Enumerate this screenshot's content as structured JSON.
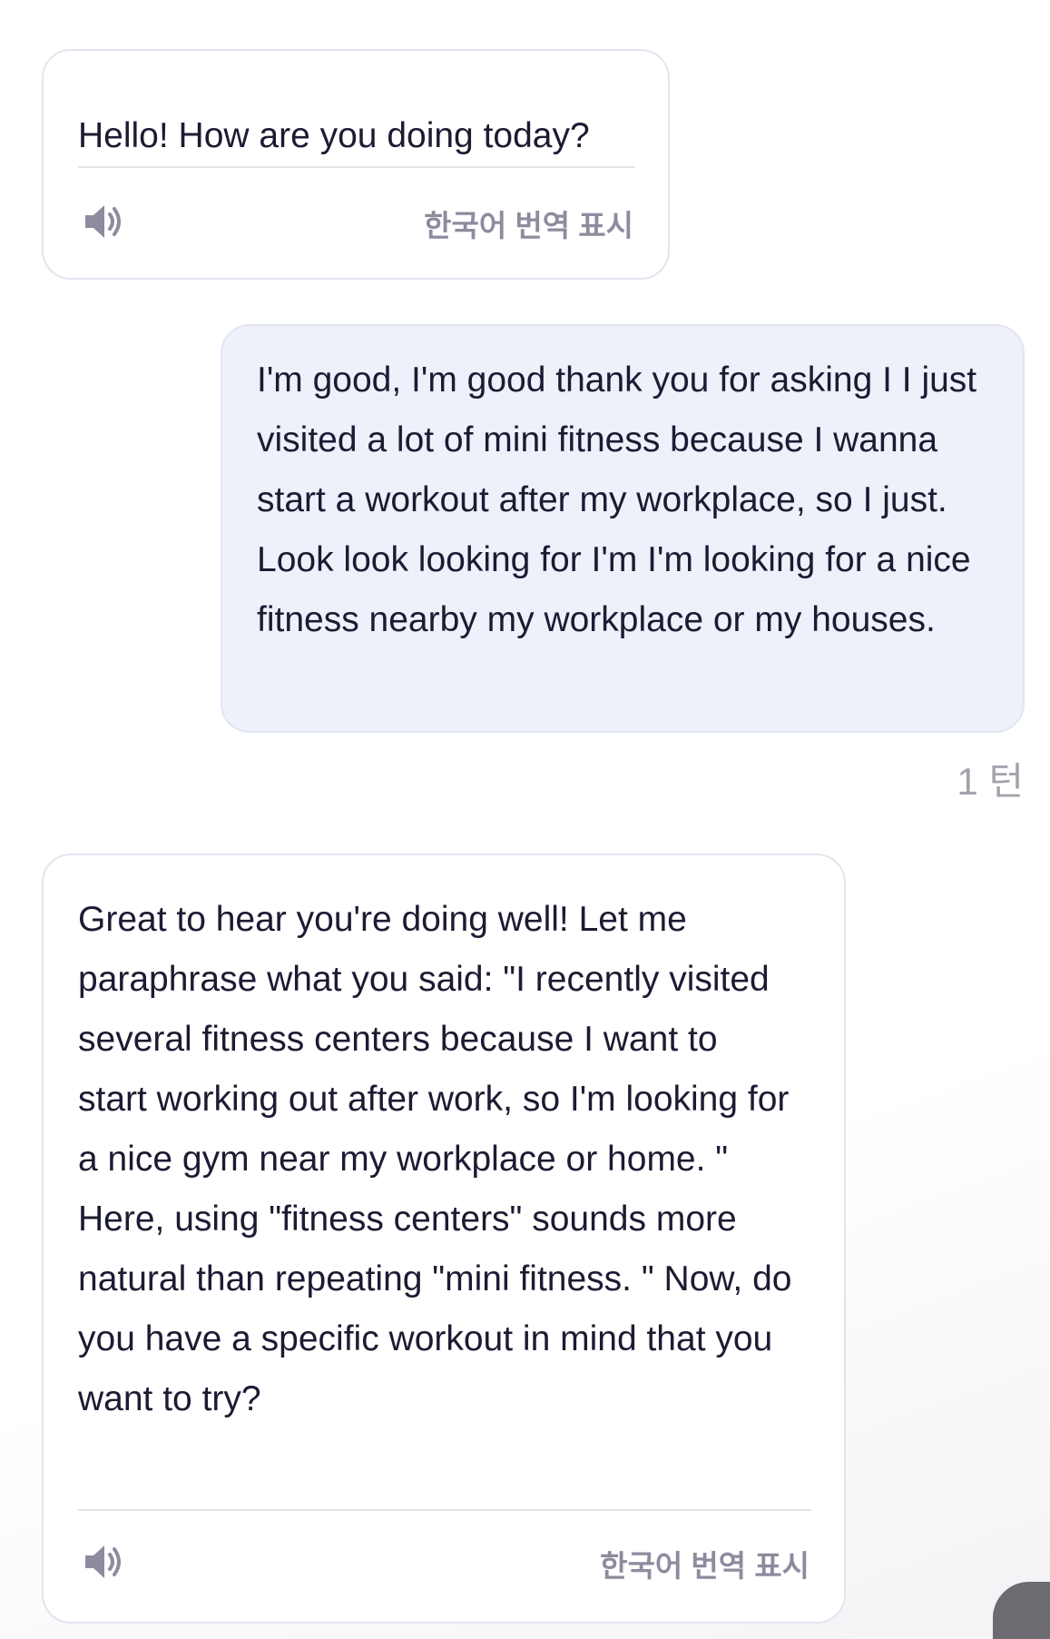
{
  "messages": [
    {
      "role": "assistant",
      "text": "Hello! How are you doing today?",
      "speaker_icon": "speaker-icon",
      "translate_label": "한국어 번역 표시"
    },
    {
      "role": "user",
      "text": "I'm good, I'm good thank you for asking I I just visited a lot of mini fitness because I wanna start a workout after my workplace, so I just. Look look looking for I'm I'm looking for a nice fitness nearby my workplace or my houses.",
      "turn_label": "1 턴"
    },
    {
      "role": "assistant",
      "text": "Great to hear you're doing well! Let me paraphrase what you said: \"I recently visited several fitness centers because I want to start working out after work, so I'm looking for a nice gym near my workplace or home. \" Here, using \"fitness centers\" sounds more natural than repeating \"mini fitness. \" Now, do you have a specific workout in mind that you want to try?",
      "speaker_icon": "speaker-icon",
      "translate_label": "한국어 번역 표시"
    }
  ],
  "colors": {
    "user_bubble": "#eef0fa",
    "assistant_bubble": "#ffffff",
    "muted_text": "#8c8c9e"
  }
}
